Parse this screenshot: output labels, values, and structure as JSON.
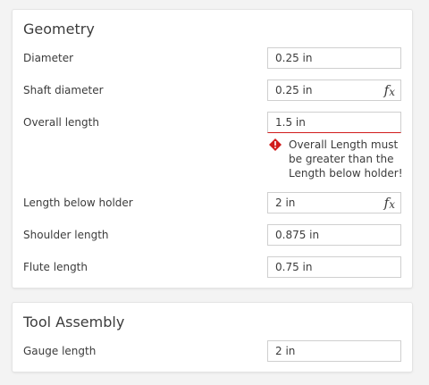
{
  "geometry": {
    "title": "Geometry",
    "diameter": {
      "label": "Diameter",
      "value": "0.25 in"
    },
    "shaft_diameter": {
      "label": "Shaft diameter",
      "value": "0.25 in",
      "fx": "f",
      "fx_sub": "x"
    },
    "overall_length": {
      "label": "Overall length",
      "value": "1.5 in",
      "error": "Overall Length must be greater than the Length below holder!"
    },
    "length_below_holder": {
      "label": "Length below holder",
      "value": "2 in",
      "fx": "f",
      "fx_sub": "x"
    },
    "shoulder_length": {
      "label": "Shoulder length",
      "value": "0.875 in"
    },
    "flute_length": {
      "label": "Flute length",
      "value": "0.75 in"
    }
  },
  "tool_assembly": {
    "title": "Tool Assembly",
    "gauge_length": {
      "label": "Gauge length",
      "value": "2 in"
    }
  },
  "colors": {
    "error": "#d11c1c",
    "border": "#cfcfcf",
    "background": "#f3f3f3"
  }
}
